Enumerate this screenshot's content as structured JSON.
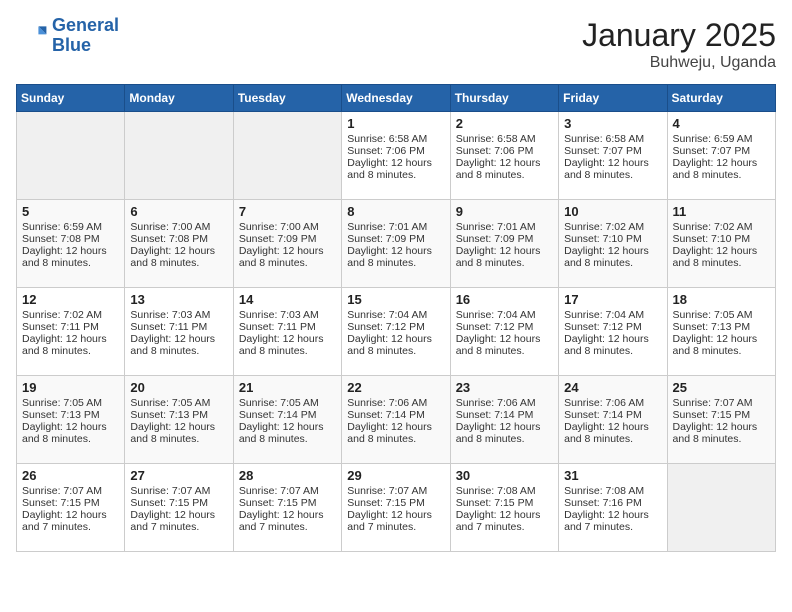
{
  "header": {
    "logo_line1": "General",
    "logo_line2": "Blue",
    "title": "January 2025",
    "subtitle": "Buhweju, Uganda"
  },
  "days_of_week": [
    "Sunday",
    "Monday",
    "Tuesday",
    "Wednesday",
    "Thursday",
    "Friday",
    "Saturday"
  ],
  "weeks": [
    [
      {
        "day": "",
        "sunrise": "",
        "sunset": "",
        "daylight": "",
        "empty": true
      },
      {
        "day": "",
        "sunrise": "",
        "sunset": "",
        "daylight": "",
        "empty": true
      },
      {
        "day": "",
        "sunrise": "",
        "sunset": "",
        "daylight": "",
        "empty": true
      },
      {
        "day": "1",
        "sunrise": "Sunrise: 6:58 AM",
        "sunset": "Sunset: 7:06 PM",
        "daylight": "Daylight: 12 hours and 8 minutes."
      },
      {
        "day": "2",
        "sunrise": "Sunrise: 6:58 AM",
        "sunset": "Sunset: 7:06 PM",
        "daylight": "Daylight: 12 hours and 8 minutes."
      },
      {
        "day": "3",
        "sunrise": "Sunrise: 6:58 AM",
        "sunset": "Sunset: 7:07 PM",
        "daylight": "Daylight: 12 hours and 8 minutes."
      },
      {
        "day": "4",
        "sunrise": "Sunrise: 6:59 AM",
        "sunset": "Sunset: 7:07 PM",
        "daylight": "Daylight: 12 hours and 8 minutes."
      }
    ],
    [
      {
        "day": "5",
        "sunrise": "Sunrise: 6:59 AM",
        "sunset": "Sunset: 7:08 PM",
        "daylight": "Daylight: 12 hours and 8 minutes."
      },
      {
        "day": "6",
        "sunrise": "Sunrise: 7:00 AM",
        "sunset": "Sunset: 7:08 PM",
        "daylight": "Daylight: 12 hours and 8 minutes."
      },
      {
        "day": "7",
        "sunrise": "Sunrise: 7:00 AM",
        "sunset": "Sunset: 7:09 PM",
        "daylight": "Daylight: 12 hours and 8 minutes."
      },
      {
        "day": "8",
        "sunrise": "Sunrise: 7:01 AM",
        "sunset": "Sunset: 7:09 PM",
        "daylight": "Daylight: 12 hours and 8 minutes."
      },
      {
        "day": "9",
        "sunrise": "Sunrise: 7:01 AM",
        "sunset": "Sunset: 7:09 PM",
        "daylight": "Daylight: 12 hours and 8 minutes."
      },
      {
        "day": "10",
        "sunrise": "Sunrise: 7:02 AM",
        "sunset": "Sunset: 7:10 PM",
        "daylight": "Daylight: 12 hours and 8 minutes."
      },
      {
        "day": "11",
        "sunrise": "Sunrise: 7:02 AM",
        "sunset": "Sunset: 7:10 PM",
        "daylight": "Daylight: 12 hours and 8 minutes."
      }
    ],
    [
      {
        "day": "12",
        "sunrise": "Sunrise: 7:02 AM",
        "sunset": "Sunset: 7:11 PM",
        "daylight": "Daylight: 12 hours and 8 minutes."
      },
      {
        "day": "13",
        "sunrise": "Sunrise: 7:03 AM",
        "sunset": "Sunset: 7:11 PM",
        "daylight": "Daylight: 12 hours and 8 minutes."
      },
      {
        "day": "14",
        "sunrise": "Sunrise: 7:03 AM",
        "sunset": "Sunset: 7:11 PM",
        "daylight": "Daylight: 12 hours and 8 minutes."
      },
      {
        "day": "15",
        "sunrise": "Sunrise: 7:04 AM",
        "sunset": "Sunset: 7:12 PM",
        "daylight": "Daylight: 12 hours and 8 minutes."
      },
      {
        "day": "16",
        "sunrise": "Sunrise: 7:04 AM",
        "sunset": "Sunset: 7:12 PM",
        "daylight": "Daylight: 12 hours and 8 minutes."
      },
      {
        "day": "17",
        "sunrise": "Sunrise: 7:04 AM",
        "sunset": "Sunset: 7:12 PM",
        "daylight": "Daylight: 12 hours and 8 minutes."
      },
      {
        "day": "18",
        "sunrise": "Sunrise: 7:05 AM",
        "sunset": "Sunset: 7:13 PM",
        "daylight": "Daylight: 12 hours and 8 minutes."
      }
    ],
    [
      {
        "day": "19",
        "sunrise": "Sunrise: 7:05 AM",
        "sunset": "Sunset: 7:13 PM",
        "daylight": "Daylight: 12 hours and 8 minutes."
      },
      {
        "day": "20",
        "sunrise": "Sunrise: 7:05 AM",
        "sunset": "Sunset: 7:13 PM",
        "daylight": "Daylight: 12 hours and 8 minutes."
      },
      {
        "day": "21",
        "sunrise": "Sunrise: 7:05 AM",
        "sunset": "Sunset: 7:14 PM",
        "daylight": "Daylight: 12 hours and 8 minutes."
      },
      {
        "day": "22",
        "sunrise": "Sunrise: 7:06 AM",
        "sunset": "Sunset: 7:14 PM",
        "daylight": "Daylight: 12 hours and 8 minutes."
      },
      {
        "day": "23",
        "sunrise": "Sunrise: 7:06 AM",
        "sunset": "Sunset: 7:14 PM",
        "daylight": "Daylight: 12 hours and 8 minutes."
      },
      {
        "day": "24",
        "sunrise": "Sunrise: 7:06 AM",
        "sunset": "Sunset: 7:14 PM",
        "daylight": "Daylight: 12 hours and 8 minutes."
      },
      {
        "day": "25",
        "sunrise": "Sunrise: 7:07 AM",
        "sunset": "Sunset: 7:15 PM",
        "daylight": "Daylight: 12 hours and 8 minutes."
      }
    ],
    [
      {
        "day": "26",
        "sunrise": "Sunrise: 7:07 AM",
        "sunset": "Sunset: 7:15 PM",
        "daylight": "Daylight: 12 hours and 7 minutes."
      },
      {
        "day": "27",
        "sunrise": "Sunrise: 7:07 AM",
        "sunset": "Sunset: 7:15 PM",
        "daylight": "Daylight: 12 hours and 7 minutes."
      },
      {
        "day": "28",
        "sunrise": "Sunrise: 7:07 AM",
        "sunset": "Sunset: 7:15 PM",
        "daylight": "Daylight: 12 hours and 7 minutes."
      },
      {
        "day": "29",
        "sunrise": "Sunrise: 7:07 AM",
        "sunset": "Sunset: 7:15 PM",
        "daylight": "Daylight: 12 hours and 7 minutes."
      },
      {
        "day": "30",
        "sunrise": "Sunrise: 7:08 AM",
        "sunset": "Sunset: 7:15 PM",
        "daylight": "Daylight: 12 hours and 7 minutes."
      },
      {
        "day": "31",
        "sunrise": "Sunrise: 7:08 AM",
        "sunset": "Sunset: 7:16 PM",
        "daylight": "Daylight: 12 hours and 7 minutes."
      },
      {
        "day": "",
        "sunrise": "",
        "sunset": "",
        "daylight": "",
        "empty": true
      }
    ]
  ]
}
